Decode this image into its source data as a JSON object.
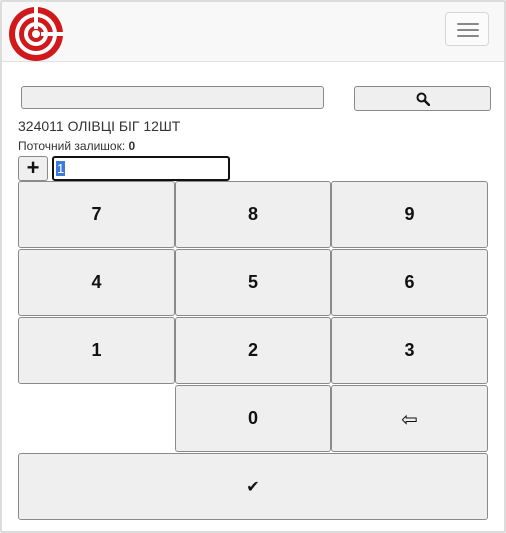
{
  "header": {
    "logo_icon": "target-logo-icon",
    "menu_icon": "hamburger-menu-icon"
  },
  "search": {
    "value": "",
    "placeholder": "",
    "button_icon": "search-icon"
  },
  "product": {
    "name": "324011 ОЛІВЦІ БІГ 12ШТ",
    "stock_label": "Поточний залишок:",
    "stock_value": "0"
  },
  "quantity": {
    "plus_label": "+",
    "value": "1"
  },
  "keypad": {
    "keys": [
      "7",
      "8",
      "9",
      "4",
      "5",
      "6",
      "1",
      "2",
      "3"
    ],
    "zero": "0",
    "backspace": "⇦",
    "confirm": "✔"
  },
  "colors": {
    "logo_red": "#d0191b",
    "selection_blue": "#3b7bd9",
    "button_bg": "#efefef"
  }
}
